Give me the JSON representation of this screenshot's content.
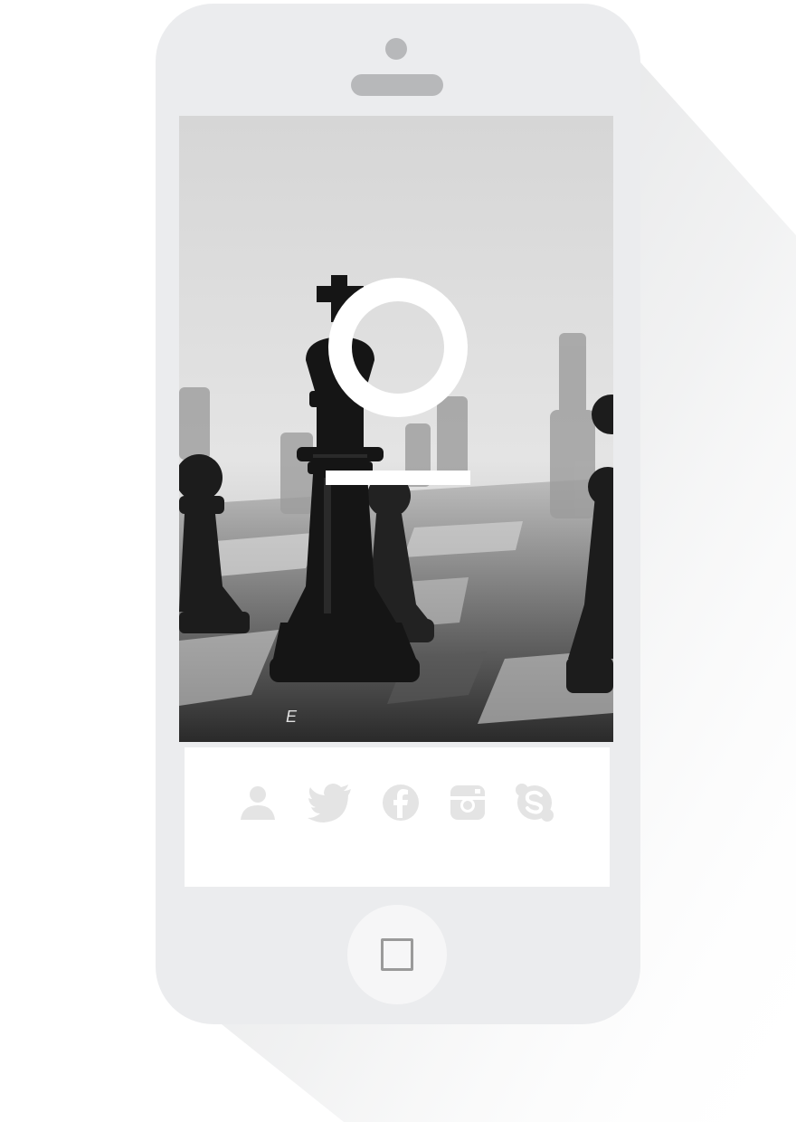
{
  "device": {
    "frame_color": "#ebecee",
    "detail_color": "#b7b8ba"
  },
  "screen": {
    "background": "chess-pieces-photo",
    "logo_icon": "ring-logo-icon",
    "logo_bar_icon": "underline-bar-icon"
  },
  "social_icons": [
    {
      "name": "user-icon"
    },
    {
      "name": "twitter-icon"
    },
    {
      "name": "facebook-icon"
    },
    {
      "name": "instagram-icon"
    },
    {
      "name": "skype-icon"
    }
  ],
  "home_button": {
    "icon": "square-home-icon"
  }
}
